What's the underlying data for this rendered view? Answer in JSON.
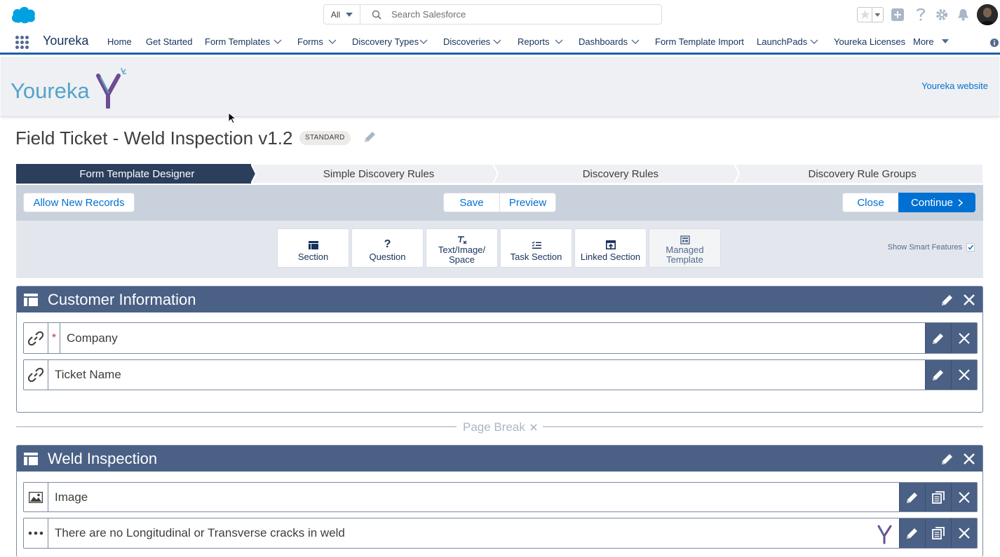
{
  "search": {
    "scope": "All",
    "placeholder": "Search Salesforce"
  },
  "nav": {
    "app_name": "Youreka",
    "items": [
      {
        "label": "Home",
        "chev": false
      },
      {
        "label": "Get Started",
        "chev": false
      },
      {
        "label": "Form Templates",
        "chev": true
      },
      {
        "label": "Forms",
        "chev": true
      },
      {
        "label": "Discovery Types",
        "chev": true
      },
      {
        "label": "Discoveries",
        "chev": true
      },
      {
        "label": "Reports",
        "chev": true
      },
      {
        "label": "Dashboards",
        "chev": true
      },
      {
        "label": "Form Template Import",
        "chev": false
      },
      {
        "label": "LaunchPads",
        "chev": true
      },
      {
        "label": "Youreka Licenses",
        "chev": false
      },
      {
        "label": "More",
        "chev": true
      }
    ]
  },
  "banner": {
    "logo_text": "Youreka",
    "website_link": "Youreka website"
  },
  "page": {
    "title": "Field Ticket - Weld Inspection v1.2",
    "badge": "STANDARD"
  },
  "path_steps": [
    {
      "label": "Form Template Designer",
      "active": true
    },
    {
      "label": "Simple Discovery Rules",
      "active": false
    },
    {
      "label": "Discovery Rules",
      "active": false
    },
    {
      "label": "Discovery Rule Groups",
      "active": false
    }
  ],
  "toolbar": {
    "allow_new_records": "Allow New Records",
    "save": "Save",
    "preview": "Preview",
    "close": "Close",
    "continue": "Continue"
  },
  "palette": {
    "section": "Section",
    "question": "Question",
    "text_image_space": "Text/Image/ Space",
    "task_section": "Task Section",
    "linked_section": "Linked Section",
    "managed_template": "Managed Template",
    "show_smart_features": "Show Smart Features",
    "show_smart_features_checked": true
  },
  "sections": [
    {
      "title": "Customer Information",
      "fields": [
        {
          "label": "Company",
          "required": true,
          "icon": "link-icon"
        },
        {
          "label": "Ticket Name",
          "required": false,
          "icon": "link-icon"
        }
      ]
    },
    {
      "title": "Weld Inspection",
      "fields": [
        {
          "label": "Image",
          "icon": "image-icon"
        },
        {
          "label": "There are no Longitudinal or Transverse cracks in weld",
          "icon": "ellipsis-icon"
        }
      ]
    }
  ],
  "page_break": {
    "label": "Page Break"
  },
  "colors": {
    "brand": "#0070d2",
    "section_header": "#4a6085",
    "nav_accent": "#1b5fa9",
    "path_active": "#2b3e5c"
  }
}
